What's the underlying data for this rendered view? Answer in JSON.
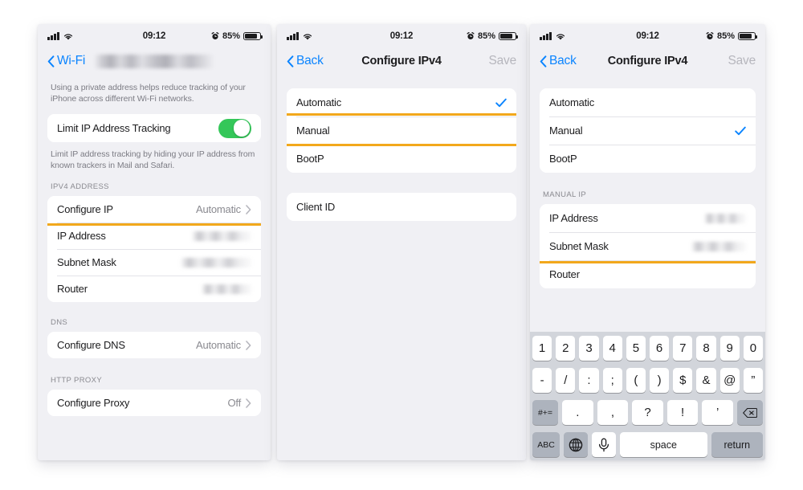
{
  "theme": {
    "accent_blue": "#0a84ff",
    "highlight_amber": "#f2a81c",
    "toggle_green": "#34c759",
    "panel_bg": "#f0f0f4",
    "card_white": "#ffffff"
  },
  "status_bar": {
    "time": "09:12",
    "battery_percent": "85%",
    "signal_icon": "cellular-signal-icon",
    "wifi_icon": "wifi-icon",
    "alarm_icon": "alarm-clock-icon",
    "battery_icon": "battery-icon"
  },
  "panel1": {
    "nav": {
      "back_label": "Wi-Fi",
      "title_redacted": true,
      "back_icon": "chevron-left-icon"
    },
    "footnote_top": "Using a private address helps reduce tracking of your iPhone across different Wi-Fi networks.",
    "limit_tracking": {
      "label": "Limit IP Address Tracking",
      "toggle_state": "on"
    },
    "footnote_tracking": "Limit IP address tracking by hiding your IP address from known trackers in Mail and Safari.",
    "ipv4_header": "IPV4 ADDRESS",
    "ipv4_rows": [
      {
        "label": "Configure IP",
        "value": "Automatic",
        "chevron": true,
        "redacted": false,
        "highlighted": true
      },
      {
        "label": "IP Address",
        "value": "",
        "chevron": false,
        "redacted": true,
        "redact_width": 74
      },
      {
        "label": "Subnet Mask",
        "value": "",
        "chevron": false,
        "redacted": true,
        "redact_width": 88
      },
      {
        "label": "Router",
        "value": "",
        "chevron": false,
        "redacted": true,
        "redact_width": 62
      }
    ],
    "dns_header": "DNS",
    "dns_rows": [
      {
        "label": "Configure DNS",
        "value": "Automatic",
        "chevron": true
      }
    ],
    "proxy_header": "HTTP PROXY",
    "proxy_rows": [
      {
        "label": "Configure Proxy",
        "value": "Off",
        "chevron": true
      }
    ]
  },
  "panel2": {
    "nav": {
      "back_label": "Back",
      "title": "Configure IPv4",
      "save_label": "Save"
    },
    "options": [
      {
        "label": "Automatic",
        "checked": true,
        "highlighted": false
      },
      {
        "label": "Manual",
        "checked": false,
        "highlighted": true
      },
      {
        "label": "BootP",
        "checked": false,
        "highlighted": false
      }
    ],
    "client_rows": [
      {
        "label": "Client ID"
      }
    ]
  },
  "panel3": {
    "nav": {
      "back_label": "Back",
      "title": "Configure IPv4",
      "save_label": "Save"
    },
    "options": [
      {
        "label": "Automatic",
        "checked": false
      },
      {
        "label": "Manual",
        "checked": true
      },
      {
        "label": "BootP",
        "checked": false
      }
    ],
    "manual_header": "MANUAL IP",
    "manual_rows": [
      {
        "label": "IP Address",
        "redacted": true,
        "redact_width": 52
      },
      {
        "label": "Subnet Mask",
        "redacted": true,
        "redact_width": 68
      },
      {
        "label": "Router",
        "redacted": false,
        "redact_width": 0
      }
    ],
    "keyboard": {
      "row1": [
        "1",
        "2",
        "3",
        "4",
        "5",
        "6",
        "7",
        "8",
        "9",
        "0"
      ],
      "row2": [
        "-",
        "/",
        ":",
        ";",
        "(",
        ")",
        "$",
        "&",
        "@",
        "”"
      ],
      "row3": [
        "#+=",
        ".",
        ",",
        "?",
        "!",
        "’",
        "delete-icon"
      ],
      "row4": [
        "ABC",
        "globe-icon",
        "microphone-icon",
        "space",
        "return"
      ],
      "symbols_key": "#+=",
      "alpha_key": "ABC",
      "space_key": "space",
      "return_key": "return",
      "delete_icon": "delete-backspace-icon",
      "globe_icon": "globe-icon",
      "mic_icon": "microphone-icon"
    }
  }
}
